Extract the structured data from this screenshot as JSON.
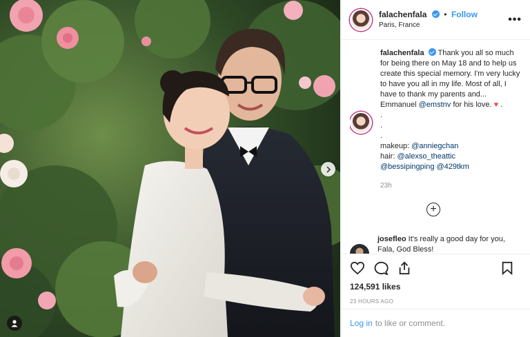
{
  "post": {
    "photo_alt": "",
    "tag_icon": "user-tag-icon",
    "next_icon": "chevron-right-icon"
  },
  "header": {
    "username": "falachenfala",
    "separator": "•",
    "follow_label": "Follow",
    "location": "Paris, France",
    "more_label": "•••"
  },
  "caption": {
    "username": "falachenfala",
    "text_1": "Thank you all so much for being there on May 18 and to help us create this special memory. I'm very lucky to have you all in my life. Most of all, I have to thank my parents and... Emmanuel",
    "mention_emmanuel": "@emstnv",
    "text_2": "for his love.",
    "heart": "♥",
    "dot_after": ".",
    "dot_line_1": ".",
    "dot_line_2": ".",
    "dot_line_3": ".",
    "makeup_label": "makeup:",
    "makeup_mention": "@anniegchan",
    "hair_label": "hair:",
    "hair_mention": "@alexso_theattic",
    "mention_3": "@bessipingping",
    "mention_4": "@429tkm",
    "time": "23h"
  },
  "load_more": {
    "label": "+"
  },
  "comment2": {
    "username": "josefleo",
    "text": "It's really a good day for you, Fala, God Bless!"
  },
  "actions": {
    "likes": "124,591 likes",
    "time_ago": "23 HOURS AGO"
  },
  "login_bar": {
    "link": "Log in",
    "text": "to like or comment."
  },
  "colors": {
    "accent": "#3897f0",
    "heart": "#ed4956",
    "story_ring": "#c13584"
  }
}
